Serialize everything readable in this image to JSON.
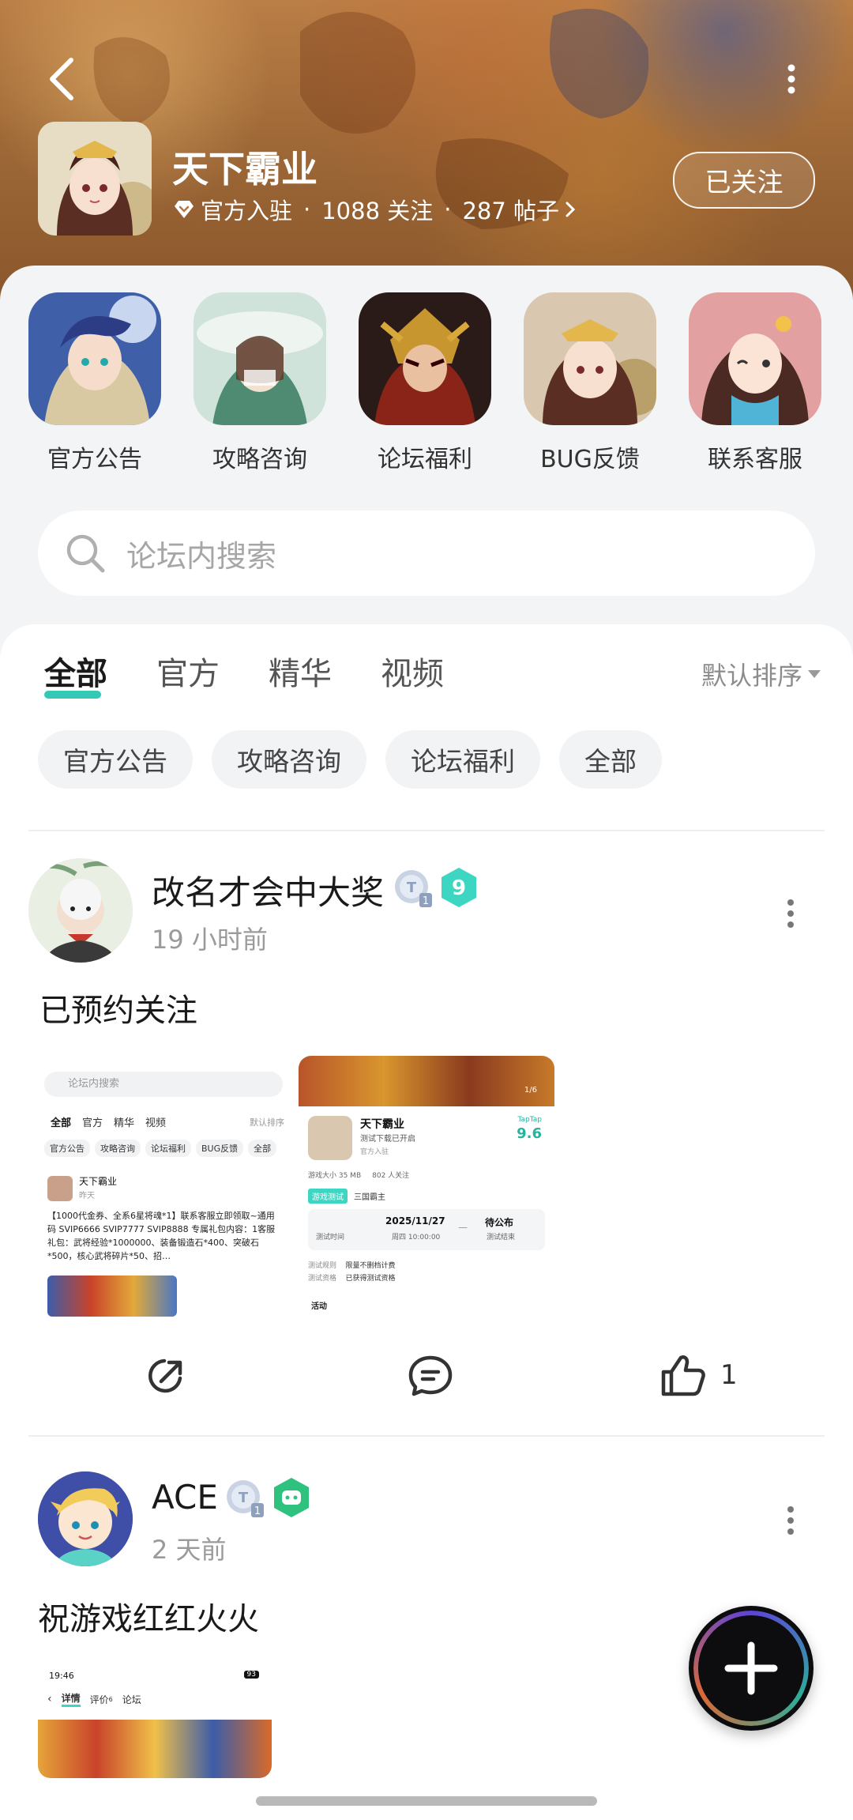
{
  "header": {
    "title": "天下霸业",
    "meta_verified": "官方入驻",
    "meta_followers": "1088 关注",
    "meta_posts": "287 帖子",
    "meta_sep": "·",
    "follow_label": "已关注"
  },
  "quick_links": [
    {
      "label": "官方公告",
      "color": "#4b6fb8"
    },
    {
      "label": "攻略咨询",
      "color": "#8fb7a8"
    },
    {
      "label": "论坛福利",
      "color": "#a93a2a"
    },
    {
      "label": "BUG反馈",
      "color": "#c9a08a"
    },
    {
      "label": "联系客服",
      "color": "#d66a6a"
    }
  ],
  "search": {
    "placeholder": "论坛内搜索"
  },
  "tabs": [
    {
      "label": "全部",
      "active": true
    },
    {
      "label": "官方",
      "active": false
    },
    {
      "label": "精华",
      "active": false
    },
    {
      "label": "视频",
      "active": false
    }
  ],
  "sort_label": "默认排序",
  "chips": [
    "官方公告",
    "攻略咨询",
    "论坛福利",
    "全部"
  ],
  "posts": [
    {
      "author": "改名才会中大奖",
      "level": "9",
      "time": "19 小时前",
      "text": "已预约关注",
      "like_count": "1",
      "shot1": {
        "search": "论坛内搜索",
        "tabs": [
          "全部",
          "官方",
          "精华",
          "视频"
        ],
        "sort": "默认排序",
        "chips": [
          "官方公告",
          "攻略咨询",
          "论坛福利",
          "BUG反馈",
          "全部"
        ],
        "author": "天下霸业",
        "time": "昨天",
        "body": "【1000代金券、全系6星将魂*1】联系客服立即领取~通用码 SVIP6666 SVIP7777 SVIP8888 专属礼包内容：1客服礼包：武将经验*1000000、装备锻造石*400、突破石*500，核心武将碎片*50、招…"
      },
      "shot2": {
        "page": "1/6",
        "title": "天下霸业",
        "subtitle": "测试下载已开启",
        "brand": "TapTap",
        "score": "9.6",
        "verified": "官方入驻",
        "size": "游戏大小 35 MB",
        "followers": "802 人关注",
        "tag": "游戏测试",
        "tag_value": "三国霸主",
        "test_label": "测试时间",
        "date": "2025/11/27",
        "weekday": "周四 10:00:00",
        "dash": "—",
        "announce": "待公布",
        "end": "测试结束",
        "rule_k": "测试规则",
        "rule_v": "限量不删档计费",
        "qual_k": "测试资格",
        "qual_v": "已获得测试资格",
        "activity": "活动"
      }
    },
    {
      "author": "ACE",
      "time": "2 天前",
      "text": "祝游戏红红火火",
      "shot": {
        "clock": "19:46",
        "tabs": [
          "详情",
          "评价",
          "论坛"
        ],
        "review_count": "6",
        "battery": "93"
      }
    }
  ],
  "colors": {
    "accent": "#33c9b4",
    "level_badge": "#3dd6c3",
    "game_badge": "#2ec27e"
  }
}
